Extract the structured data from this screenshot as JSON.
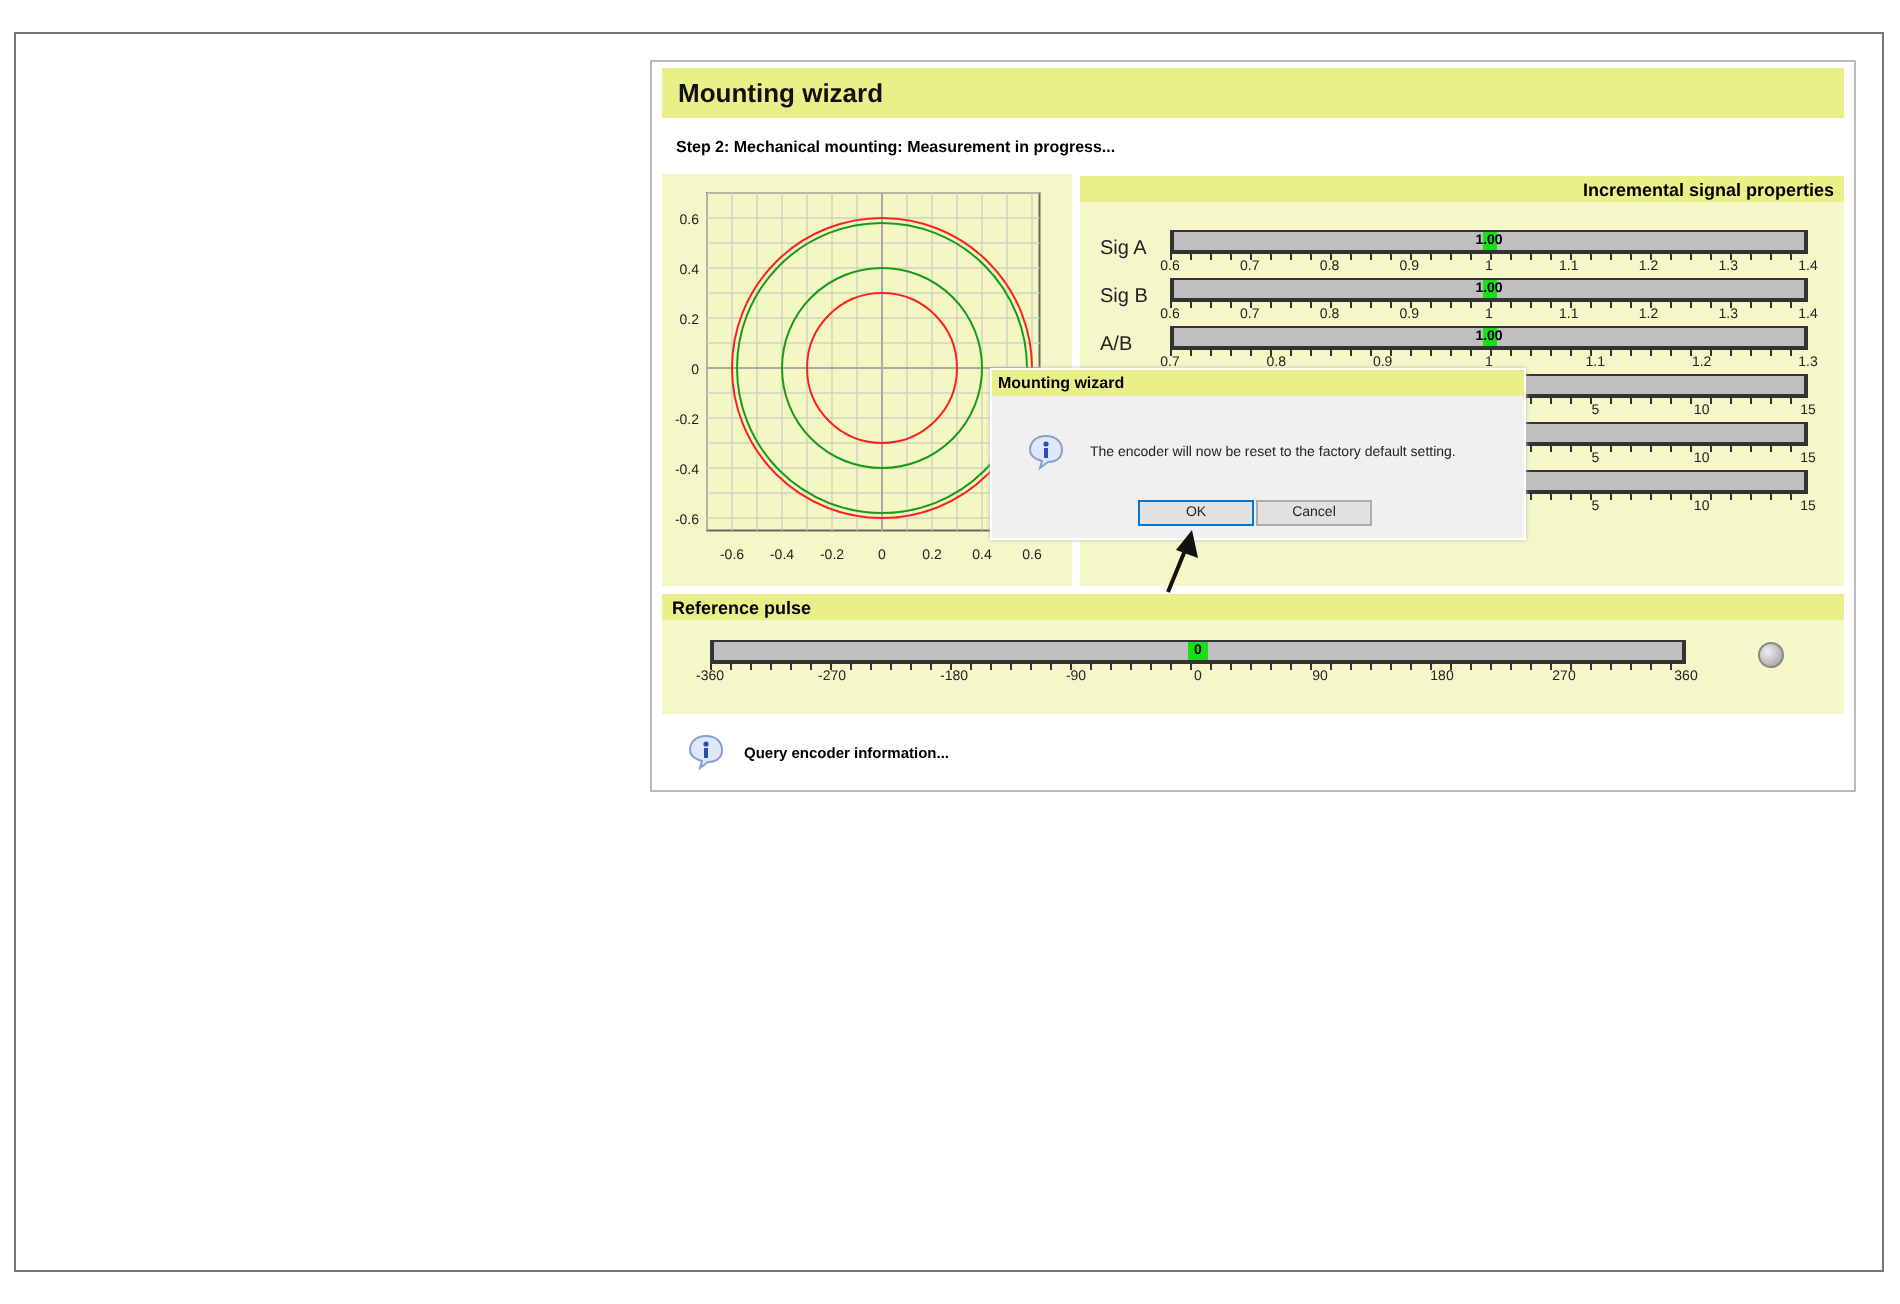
{
  "window": {
    "title": "Mounting wizard"
  },
  "step": "Step 2: Mechanical mounting: Measurement in progress...",
  "plot": {
    "x_tick_labels": [
      "-0.6",
      "-0.4",
      "-0.2",
      "0",
      "0.2",
      "0.4",
      "0.6"
    ],
    "y_tick_labels": [
      "0.6",
      "0.4",
      "0.2",
      "0",
      "-0.2",
      "-0.4",
      "-0.6"
    ]
  },
  "signals": {
    "title": "Incremental signal properties",
    "rows": [
      {
        "kind": "gauge",
        "label": "Sig A",
        "value": "1.00",
        "level": 0.5,
        "ticks": [
          "0.6",
          "0.7",
          "0.8",
          "0.9",
          "1",
          "1.1",
          "1.2",
          "1.3",
          "1.4"
        ]
      },
      {
        "kind": "gauge",
        "label": "Sig B",
        "value": "1.00",
        "level": 0.5,
        "ticks": [
          "0.6",
          "0.7",
          "0.8",
          "0.9",
          "1",
          "1.1",
          "1.2",
          "1.3",
          "1.4"
        ]
      },
      {
        "kind": "gauge",
        "label": "A/B",
        "value": "1.00",
        "level": 0.5,
        "ticks": [
          "0.7",
          "0.8",
          "0.9",
          "1",
          "1.1",
          "1.2",
          "1.3"
        ]
      },
      {
        "kind": "covered",
        "ticks": [
          "5",
          "10",
          "15"
        ]
      },
      {
        "kind": "covered",
        "ticks": [
          "5",
          "10",
          "15"
        ]
      },
      {
        "kind": "covered",
        "ticks": [
          "5",
          "10",
          "15"
        ]
      }
    ]
  },
  "reference": {
    "title": "Reference pulse",
    "value": "0",
    "level": 0.5,
    "ticks": [
      "-360",
      "-270",
      "-180",
      "-90",
      "0",
      "90",
      "180",
      "270",
      "360"
    ],
    "indicator_on": false
  },
  "status": {
    "text": "Query encoder information..."
  },
  "dialog": {
    "title": "Mounting wizard",
    "message": "The encoder will now be reset to the factory default setting.",
    "buttons": [
      {
        "label": "OK",
        "selected": true
      },
      {
        "label": "Cancel",
        "selected": false
      }
    ]
  }
}
